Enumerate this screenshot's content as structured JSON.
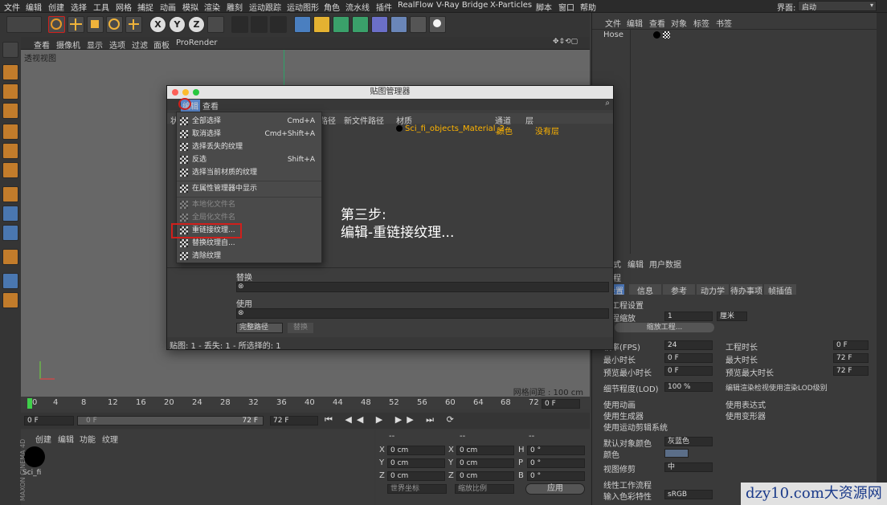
{
  "menubar": {
    "items": [
      "文件",
      "编辑",
      "创建",
      "选择",
      "工具",
      "网格",
      "捕捉",
      "动画",
      "模拟",
      "渲染",
      "雕刻",
      "运动跟踪",
      "运动图形",
      "角色",
      "流水线",
      "插件",
      "RealFlow",
      "V-Ray Bridge",
      "X-Particles",
      "脚本",
      "窗口",
      "帮助"
    ],
    "layout_label": "界面:",
    "layout_value": "启动"
  },
  "toolbar": {
    "axis_x": "X",
    "axis_y": "Y",
    "axis_z": "Z"
  },
  "viewport": {
    "menu": [
      "查看",
      "摄像机",
      "显示",
      "选项",
      "过滤",
      "面板",
      "ProRender"
    ],
    "label": "透视视图",
    "grid": "网格间距 : 100 cm"
  },
  "timeline": {
    "ticks": [
      "0",
      "4",
      "8",
      "12",
      "16",
      "20",
      "24",
      "28",
      "32",
      "36",
      "40",
      "44",
      "48",
      "52",
      "56",
      "60",
      "64",
      "68",
      "72"
    ],
    "frame": "0 F"
  },
  "transport": {
    "start": "0 F",
    "range_start": "0 F",
    "range_end": "72 F",
    "end": "72 F"
  },
  "material_panel": {
    "menu": [
      "创建",
      "编辑",
      "功能",
      "纹理"
    ],
    "material_name": "Sci_fi"
  },
  "coord": {
    "header": [
      "--",
      "--",
      "--"
    ],
    "rows": [
      [
        "X",
        "0 cm",
        "X",
        "0 cm",
        "H",
        "0 °"
      ],
      [
        "Y",
        "0 cm",
        "Y",
        "0 cm",
        "P",
        "0 °"
      ],
      [
        "Z",
        "0 cm",
        "Z",
        "0 cm",
        "B",
        "0 °"
      ]
    ],
    "world": "世界坐标",
    "scale": "缩放比例",
    "apply": "应用"
  },
  "object_manager": {
    "menu": [
      "文件",
      "编辑",
      "查看",
      "对象",
      "标签",
      "书签"
    ],
    "object": "Hose"
  },
  "attr_manager": {
    "menu": [
      "模式",
      "编辑",
      "用户数据"
    ],
    "section": "工程",
    "tabs": [
      "设置",
      "信息",
      "参考",
      "动力学",
      "待办事项",
      "帧插值"
    ],
    "subsection": "工程设置",
    "scale_label": "工程缩放",
    "scale_value": "1",
    "scale_unit": "厘米",
    "scale_button": "缩放工程...",
    "fps_label": "帧率(FPS)",
    "fps": "24",
    "time_label": "工程时长",
    "time": "0 F",
    "min_label": "最小时长",
    "min": "0 F",
    "max_label": "最大时长",
    "max": "72 F",
    "pmin_label": "预览最小时长",
    "pmin": "0 F",
    "pmax_label": "预览最大时长",
    "pmax": "72 F",
    "lod_label": "细节程度(LOD)",
    "lod": "100 %",
    "lod_note": "编辑渲染检视使用渲染LOD级别",
    "anim": "使用动画",
    "expr": "使用表达式",
    "gen": "使用生成器",
    "deform": "使用变形器",
    "motion": "使用运动剪辑系统",
    "objcolor_label": "默认对象颜色",
    "objcolor": "灰蓝色",
    "color_label": "颜色",
    "clip_label": "视图修剪",
    "clip": "中",
    "linear": "线性工作流程",
    "input_label": "输入色彩特性",
    "input": "sRGB"
  },
  "dialog": {
    "title": "贴图管理器",
    "menu": [
      "编辑",
      "查看"
    ],
    "columns": [
      "状",
      "路径",
      "新文件路径",
      "材质",
      "通道",
      "层"
    ],
    "row": {
      "material": "Sci_fi_objects_Material_2",
      "channel": "颜色",
      "layer": "没有层"
    },
    "replace_label": "替换",
    "use_label": "使用",
    "path_mode": "完整路径",
    "replace_button": "替换",
    "status": "贴图: 1 - 丢失: 1 - 所选择的: 1"
  },
  "context_menu": {
    "items": [
      {
        "label": "全部选择",
        "shortcut": "Cmd+A"
      },
      {
        "label": "取消选择",
        "shortcut": "Cmd+Shift+A"
      },
      {
        "label": "选择丢失的纹理",
        "shortcut": ""
      },
      {
        "label": "反选",
        "shortcut": "Shift+A"
      },
      {
        "label": "选择当前材质的纹理",
        "shortcut": ""
      },
      {
        "label": "在属性管理器中显示",
        "shortcut": ""
      },
      {
        "label": "本地化文件名",
        "shortcut": ""
      },
      {
        "label": "全局化文件名",
        "shortcut": ""
      },
      {
        "label": "重链接纹理...",
        "shortcut": ""
      },
      {
        "label": "替换纹理自...",
        "shortcut": ""
      },
      {
        "label": "清除纹理",
        "shortcut": ""
      }
    ]
  },
  "annotation": {
    "line1": "第三步:",
    "line2": "编辑-重链接纹理..."
  },
  "watermark": "dzy10.com大资源网",
  "colors": {
    "highlight_red": "#d0201c",
    "accent_orange": "#ffb400",
    "viewport": "#676767"
  }
}
